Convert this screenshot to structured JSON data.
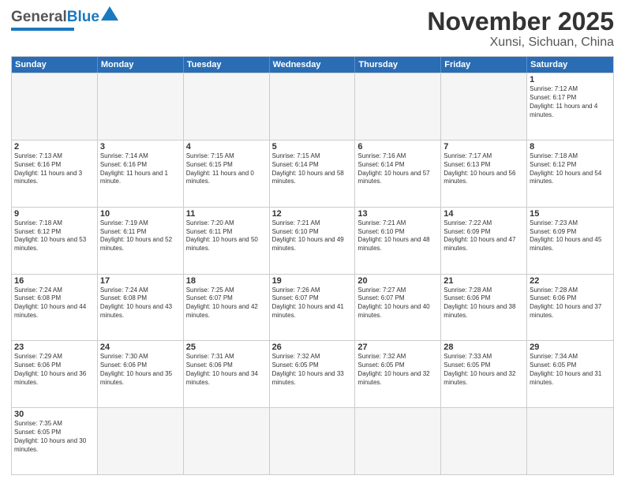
{
  "header": {
    "logo_general": "General",
    "logo_blue": "Blue",
    "title": "November 2025",
    "subtitle": "Xunsi, Sichuan, China"
  },
  "calendar": {
    "days": [
      "Sunday",
      "Monday",
      "Tuesday",
      "Wednesday",
      "Thursday",
      "Friday",
      "Saturday"
    ],
    "rows": [
      [
        {
          "day": "",
          "empty": true
        },
        {
          "day": "",
          "empty": true
        },
        {
          "day": "",
          "empty": true
        },
        {
          "day": "",
          "empty": true
        },
        {
          "day": "",
          "empty": true
        },
        {
          "day": "",
          "empty": true
        },
        {
          "day": "1",
          "sunrise": "7:12 AM",
          "sunset": "6:17 PM",
          "daylight": "11 hours and 4 minutes."
        }
      ],
      [
        {
          "day": "2",
          "sunrise": "7:13 AM",
          "sunset": "6:16 PM",
          "daylight": "11 hours and 3 minutes."
        },
        {
          "day": "3",
          "sunrise": "7:14 AM",
          "sunset": "6:16 PM",
          "daylight": "11 hours and 1 minute."
        },
        {
          "day": "4",
          "sunrise": "7:15 AM",
          "sunset": "6:15 PM",
          "daylight": "11 hours and 0 minutes."
        },
        {
          "day": "5",
          "sunrise": "7:15 AM",
          "sunset": "6:14 PM",
          "daylight": "10 hours and 58 minutes."
        },
        {
          "day": "6",
          "sunrise": "7:16 AM",
          "sunset": "6:14 PM",
          "daylight": "10 hours and 57 minutes."
        },
        {
          "day": "7",
          "sunrise": "7:17 AM",
          "sunset": "6:13 PM",
          "daylight": "10 hours and 56 minutes."
        },
        {
          "day": "8",
          "sunrise": "7:18 AM",
          "sunset": "6:12 PM",
          "daylight": "10 hours and 54 minutes."
        }
      ],
      [
        {
          "day": "9",
          "sunrise": "7:18 AM",
          "sunset": "6:12 PM",
          "daylight": "10 hours and 53 minutes."
        },
        {
          "day": "10",
          "sunrise": "7:19 AM",
          "sunset": "6:11 PM",
          "daylight": "10 hours and 52 minutes."
        },
        {
          "day": "11",
          "sunrise": "7:20 AM",
          "sunset": "6:11 PM",
          "daylight": "10 hours and 50 minutes."
        },
        {
          "day": "12",
          "sunrise": "7:21 AM",
          "sunset": "6:10 PM",
          "daylight": "10 hours and 49 minutes."
        },
        {
          "day": "13",
          "sunrise": "7:21 AM",
          "sunset": "6:10 PM",
          "daylight": "10 hours and 48 minutes."
        },
        {
          "day": "14",
          "sunrise": "7:22 AM",
          "sunset": "6:09 PM",
          "daylight": "10 hours and 47 minutes."
        },
        {
          "day": "15",
          "sunrise": "7:23 AM",
          "sunset": "6:09 PM",
          "daylight": "10 hours and 45 minutes."
        }
      ],
      [
        {
          "day": "16",
          "sunrise": "7:24 AM",
          "sunset": "6:08 PM",
          "daylight": "10 hours and 44 minutes."
        },
        {
          "day": "17",
          "sunrise": "7:24 AM",
          "sunset": "6:08 PM",
          "daylight": "10 hours and 43 minutes."
        },
        {
          "day": "18",
          "sunrise": "7:25 AM",
          "sunset": "6:07 PM",
          "daylight": "10 hours and 42 minutes."
        },
        {
          "day": "19",
          "sunrise": "7:26 AM",
          "sunset": "6:07 PM",
          "daylight": "10 hours and 41 minutes."
        },
        {
          "day": "20",
          "sunrise": "7:27 AM",
          "sunset": "6:07 PM",
          "daylight": "10 hours and 40 minutes."
        },
        {
          "day": "21",
          "sunrise": "7:28 AM",
          "sunset": "6:06 PM",
          "daylight": "10 hours and 38 minutes."
        },
        {
          "day": "22",
          "sunrise": "7:28 AM",
          "sunset": "6:06 PM",
          "daylight": "10 hours and 37 minutes."
        }
      ],
      [
        {
          "day": "23",
          "sunrise": "7:29 AM",
          "sunset": "6:06 PM",
          "daylight": "10 hours and 36 minutes."
        },
        {
          "day": "24",
          "sunrise": "7:30 AM",
          "sunset": "6:06 PM",
          "daylight": "10 hours and 35 minutes."
        },
        {
          "day": "25",
          "sunrise": "7:31 AM",
          "sunset": "6:06 PM",
          "daylight": "10 hours and 34 minutes."
        },
        {
          "day": "26",
          "sunrise": "7:32 AM",
          "sunset": "6:05 PM",
          "daylight": "10 hours and 33 minutes."
        },
        {
          "day": "27",
          "sunrise": "7:32 AM",
          "sunset": "6:05 PM",
          "daylight": "10 hours and 32 minutes."
        },
        {
          "day": "28",
          "sunrise": "7:33 AM",
          "sunset": "6:05 PM",
          "daylight": "10 hours and 32 minutes."
        },
        {
          "day": "29",
          "sunrise": "7:34 AM",
          "sunset": "6:05 PM",
          "daylight": "10 hours and 31 minutes."
        }
      ],
      [
        {
          "day": "30",
          "sunrise": "7:35 AM",
          "sunset": "6:05 PM",
          "daylight": "10 hours and 30 minutes."
        },
        {
          "day": "",
          "empty": true
        },
        {
          "day": "",
          "empty": true
        },
        {
          "day": "",
          "empty": true
        },
        {
          "day": "",
          "empty": true
        },
        {
          "day": "",
          "empty": true
        },
        {
          "day": "",
          "empty": true
        }
      ]
    ]
  }
}
